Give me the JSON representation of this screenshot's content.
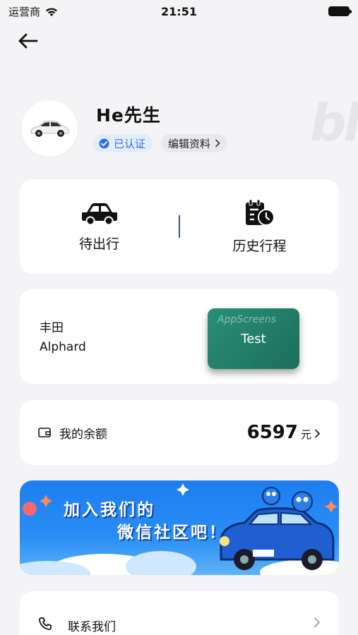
{
  "status_bar": {
    "carrier": "运营商",
    "time": "21:51"
  },
  "profile": {
    "name": "He先生",
    "verified_label": "已认证",
    "edit_label": "编辑资料"
  },
  "trips": {
    "pending_label": "待出行",
    "history_label": "历史行程"
  },
  "vehicle": {
    "brand": "丰田",
    "model": "Alphard",
    "action_label": "Test",
    "watermark": "AppScreens"
  },
  "balance": {
    "label": "我的余额",
    "amount": "6597",
    "unit": "元"
  },
  "banner": {
    "line1": "加入我们的",
    "line2": "微信社区吧！"
  },
  "contact": {
    "label": "联系我们"
  },
  "colors": {
    "accent_blue": "#2f6fe0",
    "teal_button": "#1c6e5b",
    "background": "#f4f4f6"
  },
  "icons": [
    "wifi-icon",
    "battery-icon",
    "back-arrow-icon",
    "car-icon",
    "calendar-clock-icon",
    "verified-icon",
    "chevron-right-icon",
    "wallet-icon",
    "phone-icon"
  ]
}
